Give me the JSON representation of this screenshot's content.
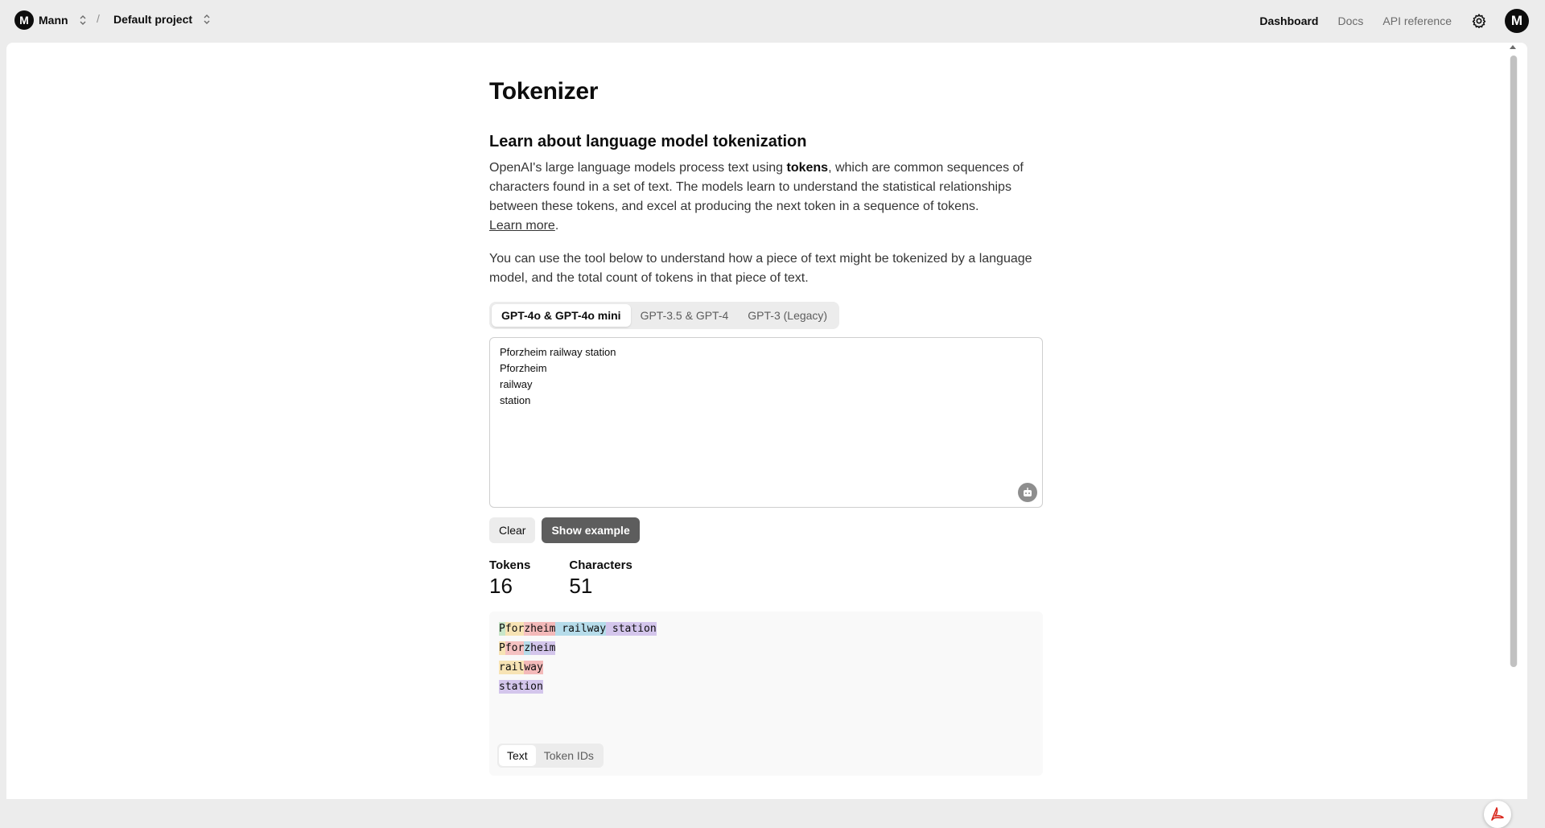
{
  "topbar": {
    "org_initial": "M",
    "org_name": "Mann",
    "separator": "/",
    "project_name": "Default project",
    "nav": [
      {
        "label": "Dashboard",
        "active": true
      },
      {
        "label": "Docs",
        "active": false
      },
      {
        "label": "API reference",
        "active": false
      }
    ],
    "user_initial": "M"
  },
  "page": {
    "title": "Tokenizer",
    "subtitle": "Learn about language model tokenization",
    "intro_before": "OpenAI's large language models process text using ",
    "intro_bold": "tokens",
    "intro_after": ", which are common sequences of characters found in a set of text. The models learn to understand the statistical relationships between these tokens, and excel at producing the next token in a sequence of tokens.",
    "learn_more": "Learn more",
    "learn_more_tail": ".",
    "tool_description": "You can use the tool below to understand how a piece of text might be tokenized by a language model, and the total count of tokens in that piece of text."
  },
  "model_tabs": [
    {
      "label": "GPT-4o & GPT-4o mini",
      "selected": true
    },
    {
      "label": "GPT-3.5 & GPT-4",
      "selected": false
    },
    {
      "label": "GPT-3 (Legacy)",
      "selected": false
    }
  ],
  "input_text": "Pforzheim railway station\nPforzheim\nrailway\nstation",
  "buttons": {
    "clear": "Clear",
    "show_example": "Show example"
  },
  "stats": {
    "tokens_label": "Tokens",
    "tokens_value": "16",
    "characters_label": "Characters",
    "characters_value": "51"
  },
  "tokens": [
    [
      {
        "text": "P",
        "color": "#c9e6c9"
      },
      {
        "text": "for",
        "color": "#f7e3b5"
      },
      {
        "text": "z",
        "color": "#f5c2c2"
      },
      {
        "text": "heim",
        "color": "#f3b9b9"
      },
      {
        "text": " railway",
        "color": "#b6dcea"
      },
      {
        "text": " station",
        "color": "#d4c6ec"
      },
      {
        "text": "\n",
        "color": "#c9e6c9"
      }
    ],
    [
      {
        "text": "P",
        "color": "#f7e3b5"
      },
      {
        "text": "for",
        "color": "#f5c2c2"
      },
      {
        "text": "z",
        "color": "#b6dcea"
      },
      {
        "text": "heim",
        "color": "#d4c6ec"
      },
      {
        "text": "\n",
        "color": "#c9e6c9"
      }
    ],
    [
      {
        "text": "rail",
        "color": "#f7e3b5"
      },
      {
        "text": "way",
        "color": "#f3b9b9"
      },
      {
        "text": "\n",
        "color": "#b6dcea"
      }
    ],
    [
      {
        "text": "station",
        "color": "#d4c6ec"
      }
    ]
  ],
  "view_tabs": [
    {
      "label": "Text",
      "selected": true
    },
    {
      "label": "Token IDs",
      "selected": false
    }
  ]
}
